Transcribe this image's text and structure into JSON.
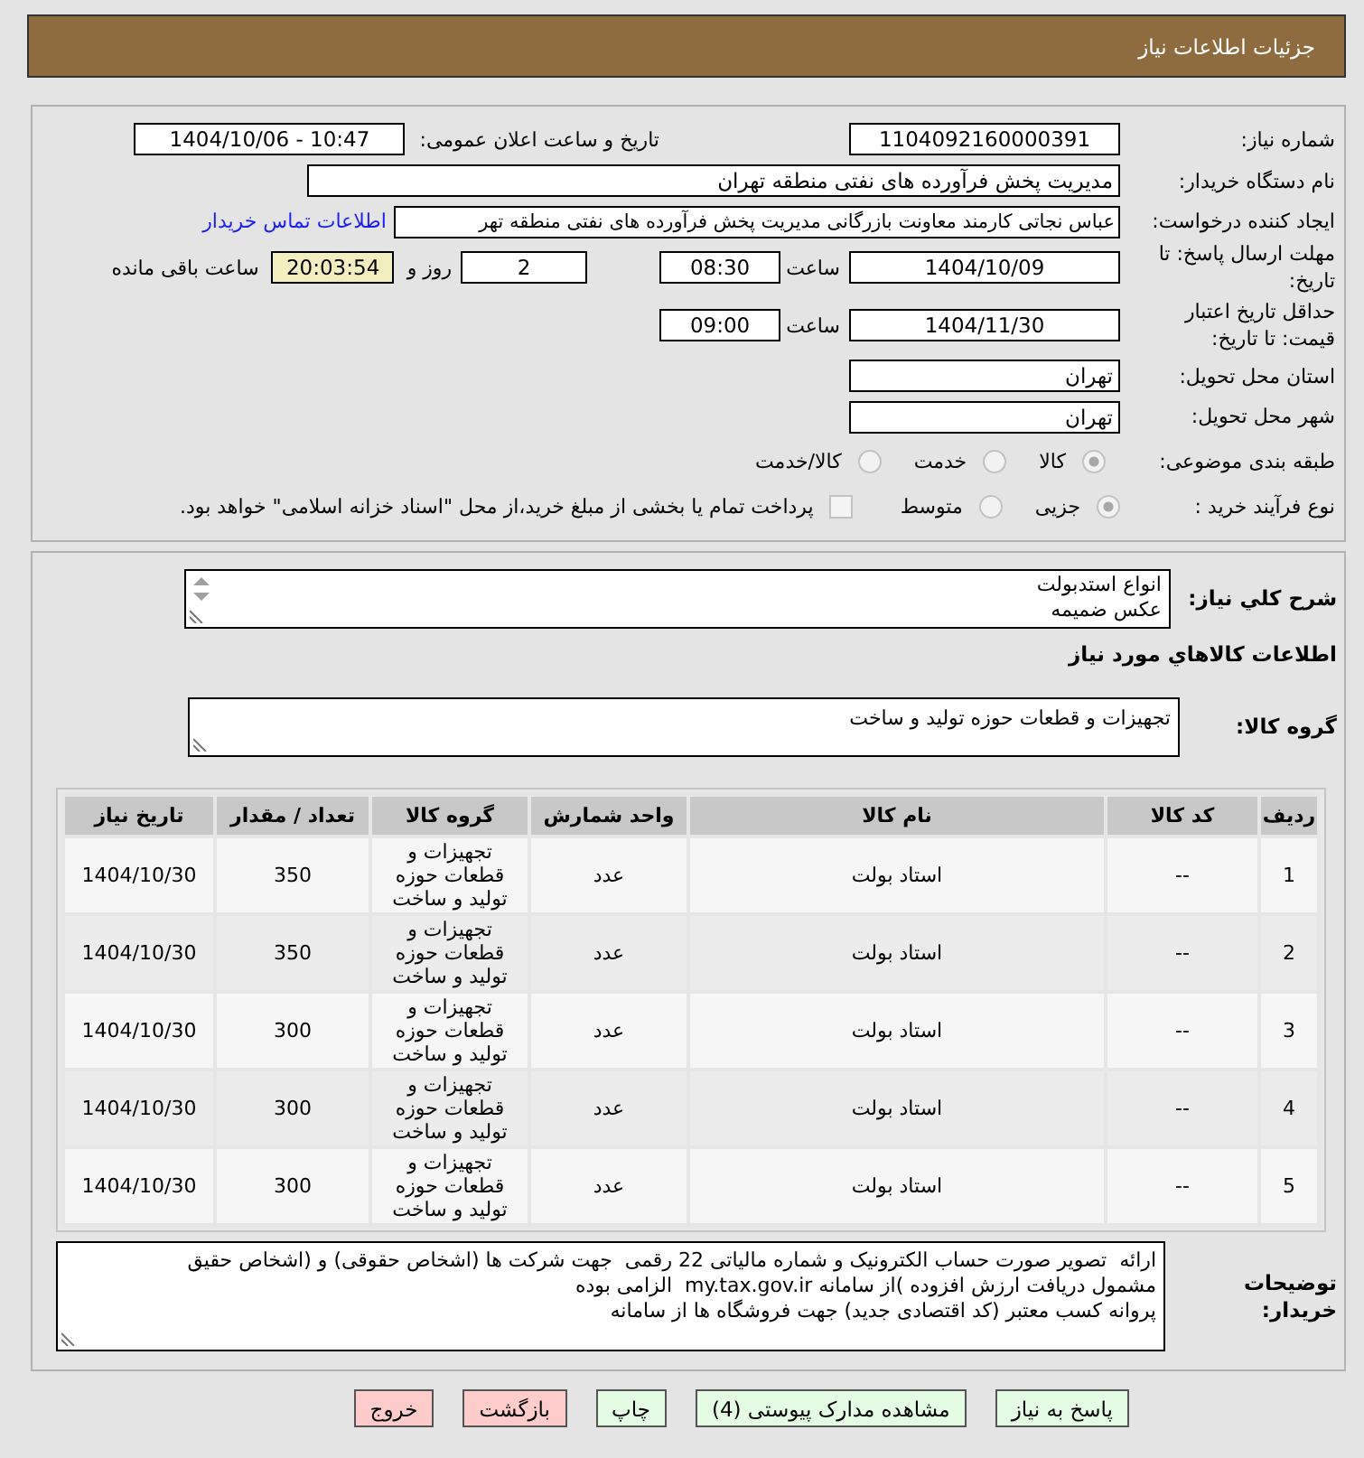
{
  "header": {
    "title": "جزئیات اطلاعات نیاز"
  },
  "details": {
    "need_number": {
      "label": "شماره نیاز:",
      "value": "1104092160000391"
    },
    "announce": {
      "label": "تاریخ و ساعت اعلان عمومی:",
      "value": "1404/10/06 - 10:47"
    },
    "buyer_org": {
      "label": "نام دستگاه خریدار:",
      "value": "مدیریت پخش فرآورده های نفتی منطقه تهران"
    },
    "requester": {
      "label": "ایجاد کننده درخواست:",
      "value": "عباس نجاتی کارمند معاونت بازرگانی مدیریت پخش فرآورده های نفتی منطقه تهر",
      "link": "اطلاعات تماس خریدار"
    },
    "deadline": {
      "label": "مهلت ارسال پاسخ: تا تاریخ:",
      "date": "1404/10/09",
      "time_label": "ساعت",
      "time": "08:30",
      "days": "2",
      "days_label": "روز و",
      "remaining": "20:03:54",
      "remaining_label": "ساعت باقی مانده"
    },
    "validity": {
      "label": "حداقل تاریخ اعتبار قیمت: تا تاریخ:",
      "date": "1404/11/30",
      "time_label": "ساعت",
      "time": "09:00"
    },
    "province": {
      "label": "استان محل تحویل:",
      "value": "تهران"
    },
    "city": {
      "label": "شهر محل تحویل:",
      "value": "تهران"
    },
    "category": {
      "label": "طبقه بندی موضوعی:",
      "options": [
        {
          "label": "کالا",
          "selected": true
        },
        {
          "label": "خدمت",
          "selected": false
        },
        {
          "label": "کالا/خدمت",
          "selected": false
        }
      ]
    },
    "process": {
      "label": "نوع فرآیند خرید :",
      "options": [
        {
          "label": "جزیی",
          "selected": true
        },
        {
          "label": "متوسط",
          "selected": false
        }
      ],
      "treasury": {
        "label": "پرداخت تمام یا بخشی از مبلغ خرید،از محل \"اسناد خزانه اسلامی\" خواهد بود.",
        "checked": false
      }
    }
  },
  "description": {
    "label": "شرح كلي نياز:",
    "value": "انواع استدبولت\nعکس ضمیمه"
  },
  "goods": {
    "title": "اطلاعات كالاهاي مورد نياز",
    "group": {
      "label": "گروه کالا:",
      "value": "تجهیزات و قطعات حوزه تولید و ساخت"
    },
    "table": {
      "columns": [
        "ردیف",
        "کد کالا",
        "نام کالا",
        "واحد شمارش",
        "گروه کالا",
        "تعداد / مقدار",
        "تاریخ نیاز"
      ],
      "rows": [
        {
          "cells": [
            "1",
            "--",
            "استاد بولت",
            "عدد",
            "تجهیزات و قطعات حوزه تولید و ساخت",
            "350",
            "1404/10/30"
          ]
        },
        {
          "cells": [
            "2",
            "--",
            "استاد بولت",
            "عدد",
            "تجهیزات و قطعات حوزه تولید و ساخت",
            "350",
            "1404/10/30"
          ]
        },
        {
          "cells": [
            "3",
            "--",
            "استاد بولت",
            "عدد",
            "تجهیزات و قطعات حوزه تولید و ساخت",
            "300",
            "1404/10/30"
          ]
        },
        {
          "cells": [
            "4",
            "--",
            "استاد بولت",
            "عدد",
            "تجهیزات و قطعات حوزه تولید و ساخت",
            "300",
            "1404/10/30"
          ]
        },
        {
          "cells": [
            "5",
            "--",
            "استاد بولت",
            "عدد",
            "تجهیزات و قطعات حوزه تولید و ساخت",
            "300",
            "1404/10/30"
          ]
        }
      ]
    }
  },
  "buyer_notes": {
    "label": "توضیحات خریدار:",
    "value": "ارائه  تصویر صورت حساب الکترونیک و شماره مالیاتی 22 رقمی  جهت شرکت ها (اشخاص حقوقی) و (اشخاص حقیق\nمشمول دریافت ارزش افزوده )از سامانه my.tax.gov.ir  الزامی بوده\nپروانه کسب معتبر (کد اقتصادی جدید) جهت فروشگاه ها از سامانه"
  },
  "buttons": [
    {
      "label": "پاسخ به نیاز",
      "color": "#e4fbe4"
    },
    {
      "label": "مشاهده مدارک پیوستی (4)",
      "color": "#e4fbe4"
    },
    {
      "label": "چاپ",
      "color": "#e4fbe4"
    },
    {
      "label": "بازگشت",
      "color": "#ffcccc"
    },
    {
      "label": "خروج",
      "color": "#ffcccc"
    }
  ]
}
